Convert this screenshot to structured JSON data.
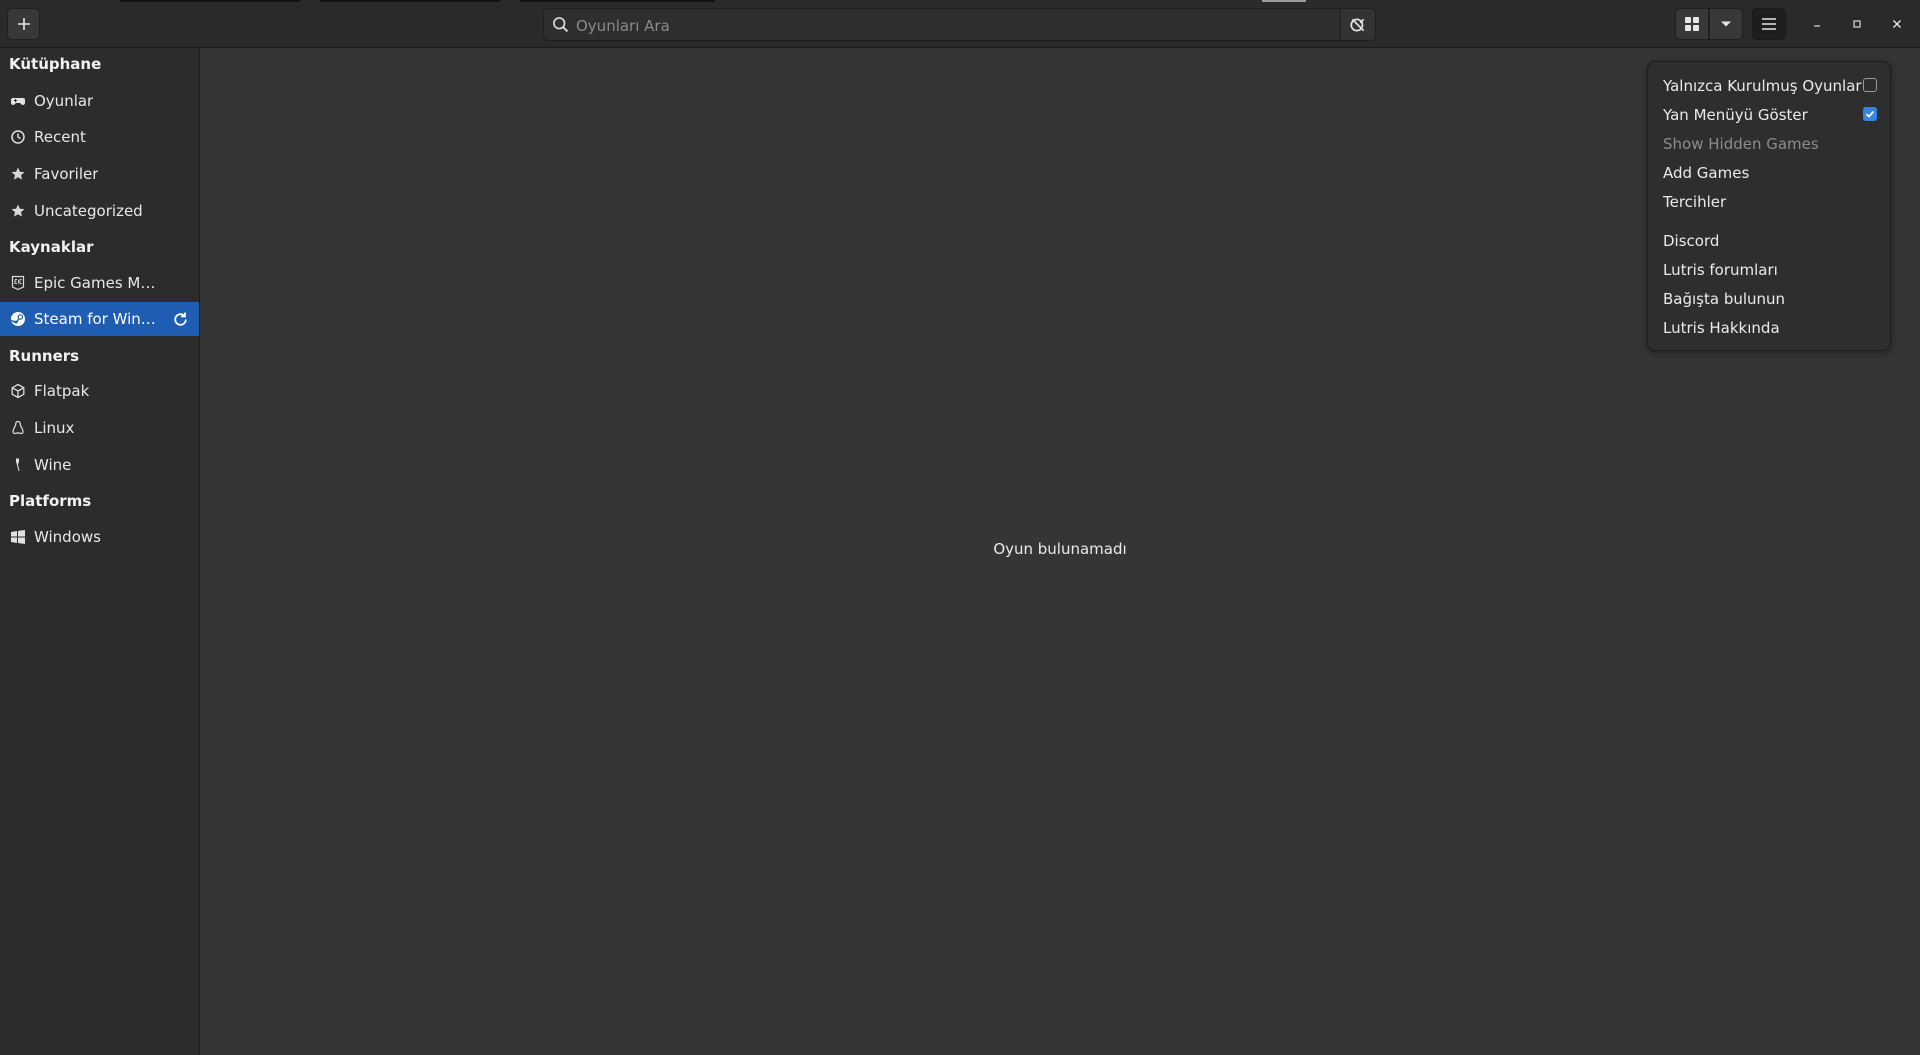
{
  "header": {
    "add_icon": "plus-icon",
    "search_placeholder": "Oyunları Ara",
    "search_value": "",
    "view_icon": "grid-icon",
    "view_dropdown_icon": "chevron-down-icon",
    "menu_icon": "hamburger-icon"
  },
  "sidebar": {
    "sections": {
      "library": "Kütüphane",
      "sources": "Kaynaklar",
      "runners": "Runners",
      "platforms": "Platforms"
    },
    "items": {
      "games": "Oyunlar",
      "recent": "Recent",
      "favorites": "Favoriler",
      "uncategorized": "Uncategorized",
      "epic": "Epic Games Mağazası",
      "steam": "Steam for Windows",
      "flatpak": "Flatpak",
      "linux": "Linux",
      "wine": "Wine",
      "windows": "Windows"
    }
  },
  "main": {
    "empty_message": "Oyun bulunamadı"
  },
  "menu": {
    "installed_only": "Yalnızca Kurulmuş Oyunlar",
    "installed_only_checked": false,
    "show_sidebar": "Yan Menüyü Göster",
    "show_sidebar_checked": true,
    "show_hidden": "Show Hidden Games",
    "add_games": "Add Games",
    "preferences": "Tercihler",
    "discord": "Discord",
    "forums": "Lutris forumları",
    "donate": "Bağışta bulunun",
    "about": "Lutris Hakkında"
  },
  "colors": {
    "accent": "#3584e4",
    "selection": "#1f5db3",
    "background": "#353535",
    "sidebar": "#2c2c2c"
  }
}
